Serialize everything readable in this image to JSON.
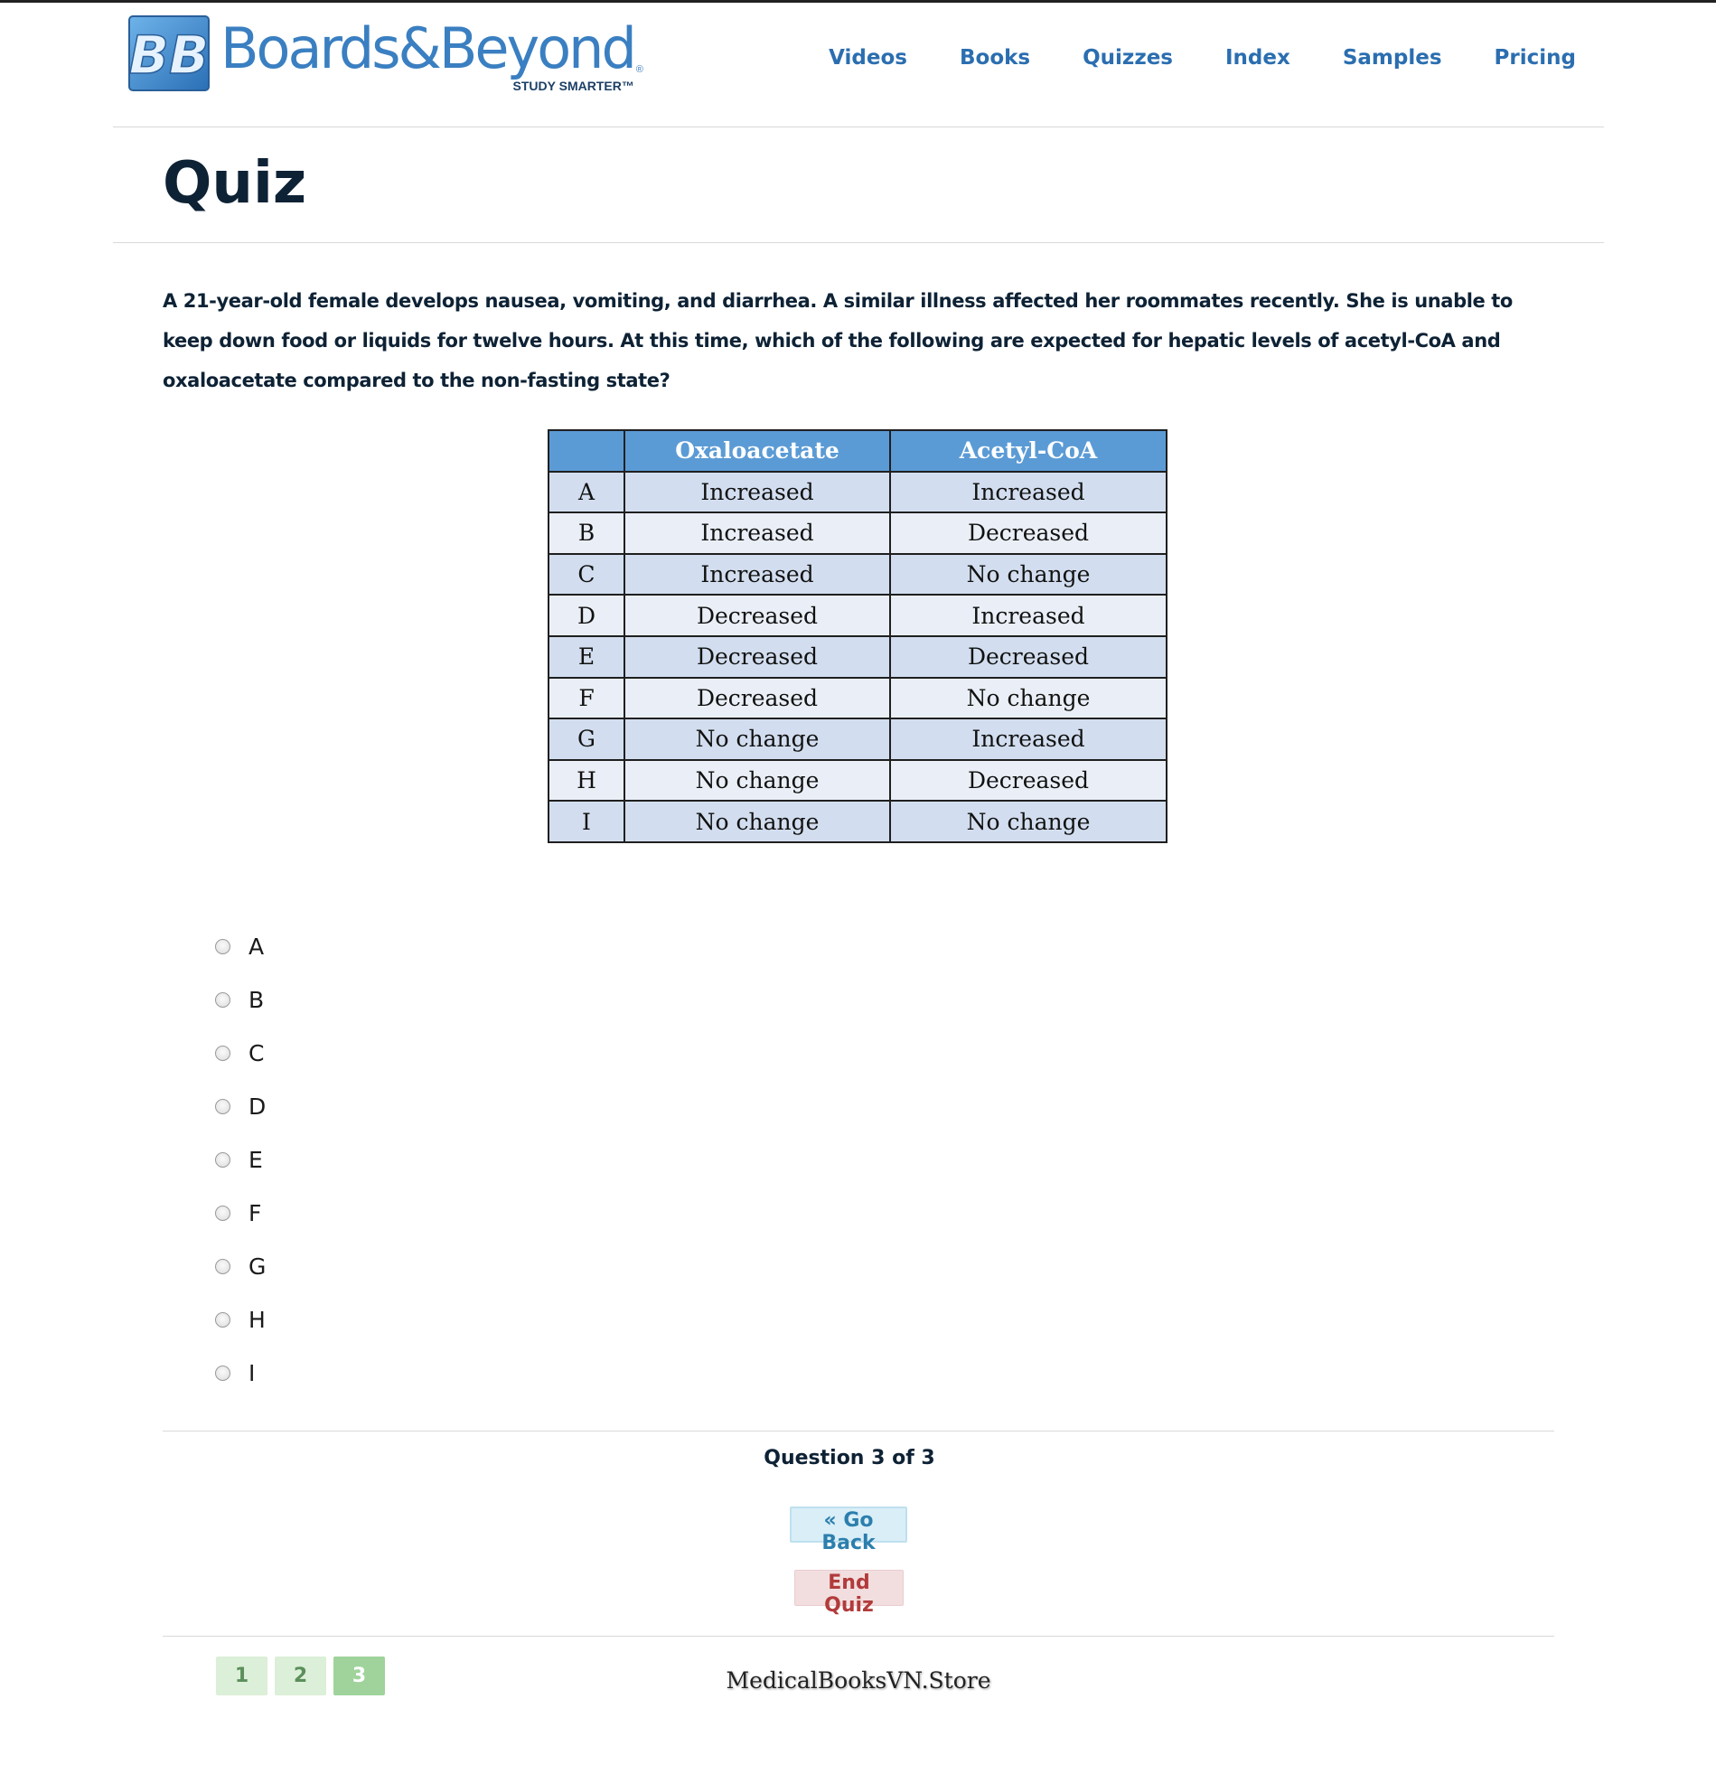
{
  "brand": {
    "monogram": "BB",
    "name": "Boards&Beyond",
    "registered": "®",
    "tagline": "STUDY SMARTER™"
  },
  "nav": {
    "items": [
      "Videos",
      "Books",
      "Quizzes",
      "Index",
      "Samples",
      "Pricing"
    ]
  },
  "page": {
    "title": "Quiz"
  },
  "question": {
    "text": "A 21-year-old female develops nausea, vomiting, and diarrhea. A similar illness affected her roommates recently.  She is unable to keep down food or liquids for twelve hours. At this time, which of the following are expected for hepatic levels of acetyl-CoA and oxaloacetate compared to the non-fasting state?",
    "table": {
      "headers": [
        "",
        "Oxaloacetate",
        "Acetyl-CoA"
      ],
      "rows": [
        [
          "A",
          "Increased",
          "Increased"
        ],
        [
          "B",
          "Increased",
          "Decreased"
        ],
        [
          "C",
          "Increased",
          "No change"
        ],
        [
          "D",
          "Decreased",
          "Increased"
        ],
        [
          "E",
          "Decreased",
          "Decreased"
        ],
        [
          "F",
          "Decreased",
          "No change"
        ],
        [
          "G",
          "No change",
          "Increased"
        ],
        [
          "H",
          "No change",
          "Decreased"
        ],
        [
          "I",
          "No change",
          "No change"
        ]
      ]
    },
    "options": [
      "A",
      "B",
      "C",
      "D",
      "E",
      "F",
      "G",
      "H",
      "I"
    ]
  },
  "status": {
    "counter": "Question 3 of 3"
  },
  "buttons": {
    "go_back": "« Go Back",
    "end_quiz": "End Quiz"
  },
  "pagination": {
    "pages": [
      "1",
      "2",
      "3"
    ],
    "active": "3"
  },
  "watermark": "MedicalBooksVN.Store",
  "colors": {
    "brand_blue": "#3a7fc1",
    "nav_link": "#2b6eb0",
    "table_header": "#5b9bd5",
    "table_row_dark": "#d2deef",
    "table_row_light": "#eaeff7",
    "back_button": "#d9eef7",
    "end_button": "#f2dede",
    "page_active": "#9fd39b"
  }
}
